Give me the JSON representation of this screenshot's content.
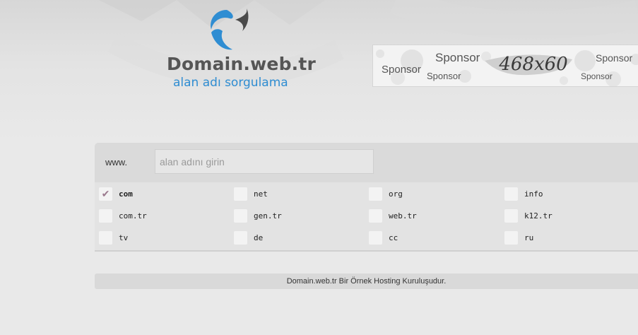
{
  "logo": {
    "title": "Domain.web.tr",
    "subtitle": "alan adı sorgulama",
    "colors": {
      "title": "#555555",
      "subtitle": "#2f8dd2",
      "mark_blue": "#2f8dd2",
      "mark_dark": "#4a4a4a"
    }
  },
  "banner": {
    "sponsor_texts": [
      "Sponsor",
      "Sponsor",
      "Sponsor",
      "Sponsor",
      "Sponsor"
    ],
    "size_text": "468x60"
  },
  "search": {
    "prefix": "www.",
    "input_value": "",
    "placeholder": "alan adını girin"
  },
  "tlds": [
    {
      "label": "com",
      "checked": true
    },
    {
      "label": "net",
      "checked": false
    },
    {
      "label": "org",
      "checked": false
    },
    {
      "label": "info",
      "checked": false
    },
    {
      "label": "com.tr",
      "checked": false
    },
    {
      "label": "gen.tr",
      "checked": false
    },
    {
      "label": "web.tr",
      "checked": false
    },
    {
      "label": "k12.tr",
      "checked": false
    },
    {
      "label": "tv",
      "checked": false
    },
    {
      "label": "de",
      "checked": false
    },
    {
      "label": "cc",
      "checked": false
    },
    {
      "label": "ru",
      "checked": false
    }
  ],
  "check_mark": "✔",
  "footer": {
    "text": "Domain.web.tr Bir Örnek Hosting Kuruluşudur."
  }
}
